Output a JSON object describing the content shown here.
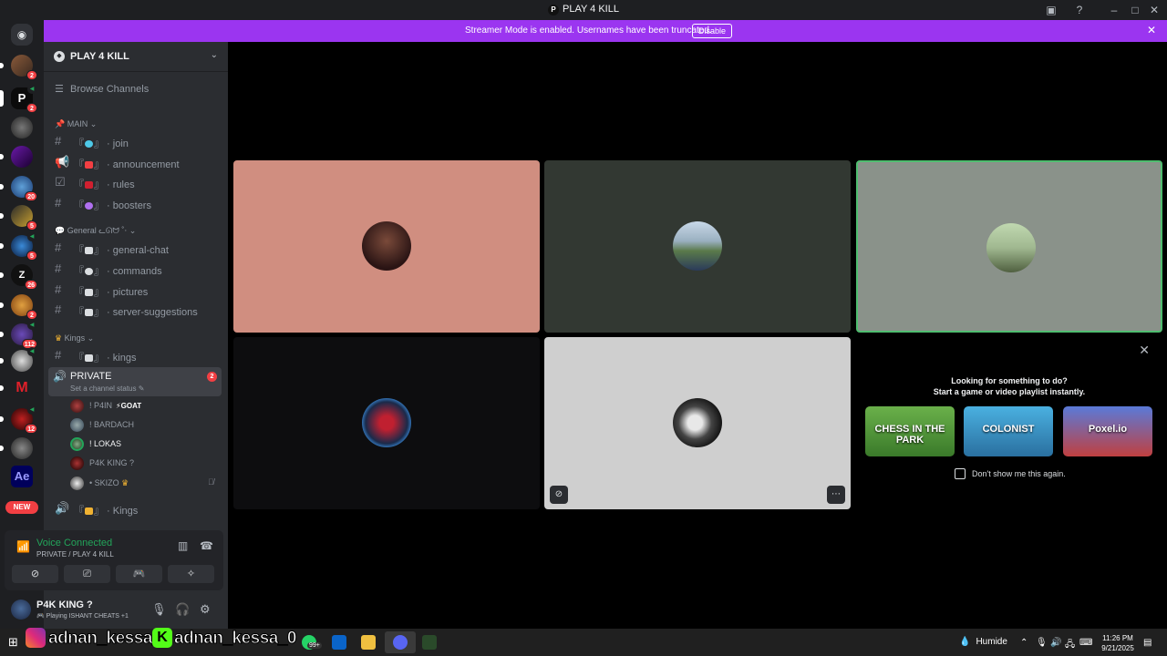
{
  "window": {
    "title": "PLAY 4 KILL"
  },
  "banner": {
    "text": "Streamer Mode is enabled. Usernames have been truncated.",
    "button": "Disable"
  },
  "rail": {
    "badges": [
      "2",
      "2",
      "20",
      "5",
      "5",
      "26",
      "2",
      "112",
      "12"
    ],
    "new_label": "NEW",
    "ae_label": "Ae",
    "m_label": "M"
  },
  "sidebar": {
    "server_name": "PLAY 4 KILL",
    "browse": "Browse Channels",
    "categories": {
      "main": "MAIN",
      "general": "General ᓚᘏᗢ ˚‧",
      "kings": "Kings"
    },
    "channels": {
      "join": "join",
      "announcement": "announcement",
      "rules": "rules",
      "boosters": "boosters",
      "general_chat": "general-chat",
      "commands": "commands",
      "pictures": "pictures",
      "server_suggestions": "server-suggestions",
      "kings": "kings",
      "kings_voice": "Kings"
    },
    "voice_private": {
      "name": "PRIVATE",
      "status": "Set a channel status",
      "count": "2"
    },
    "voice_users": [
      {
        "name": "! P4IN",
        "tag": "GOAT"
      },
      {
        "name": "! BARDACH",
        "tag": ""
      },
      {
        "name": "! LOKAS",
        "tag": ""
      },
      {
        "name": "P4K KING ?",
        "tag": ""
      },
      {
        "name": "• SKIZO",
        "tag": ""
      }
    ]
  },
  "voice_panel": {
    "title": "Voice Connected",
    "subtitle": "PRIVATE / PLAY 4 KILL"
  },
  "user_panel": {
    "name": "P4K KING ?",
    "status_prefix": "Playing ISHANT CHEATS",
    "status_extra": "+1"
  },
  "activity": {
    "line1": "Looking for something to do?",
    "line2": "Start a game or video playlist instantly.",
    "games": [
      "CHESS IN THE PARK",
      "COLONIST",
      "Poxel.io"
    ],
    "checkbox_label": "Don't show me this again."
  },
  "taskbar": {
    "overlay_1": "adnan_kessa_",
    "overlay_2": "adnan_kessa_0",
    "whatsapp_badge": "99+",
    "weather": "Humide",
    "time": "11:26 PM",
    "date": "9/21/2025"
  },
  "colors": {
    "accent_purple": "#9b35f0",
    "voice_green": "#23a55a",
    "badge_red": "#f23f43",
    "tile_salmon": "#d08e80",
    "tile_dark_green": "#323832",
    "tile_gray_green": "#8a928a",
    "speaking_border": "#4fbd6f"
  }
}
